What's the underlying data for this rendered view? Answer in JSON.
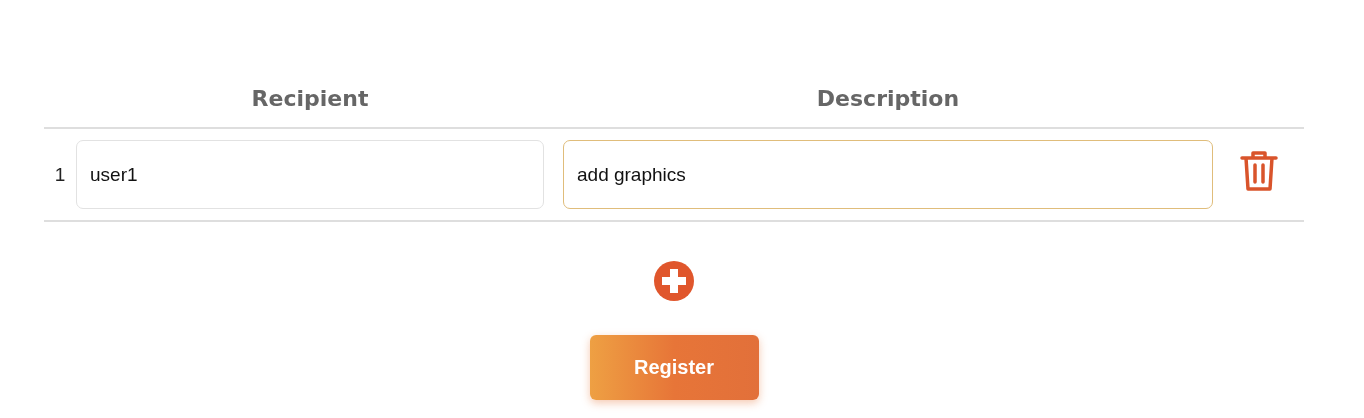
{
  "table": {
    "columns": [
      "Recipient",
      "Description"
    ],
    "rows": [
      {
        "number": "1",
        "recipient": {
          "value": "user1",
          "focused": false
        },
        "description": {
          "value": "add graphics",
          "focused": true
        }
      }
    ]
  },
  "register_button": "Register"
}
